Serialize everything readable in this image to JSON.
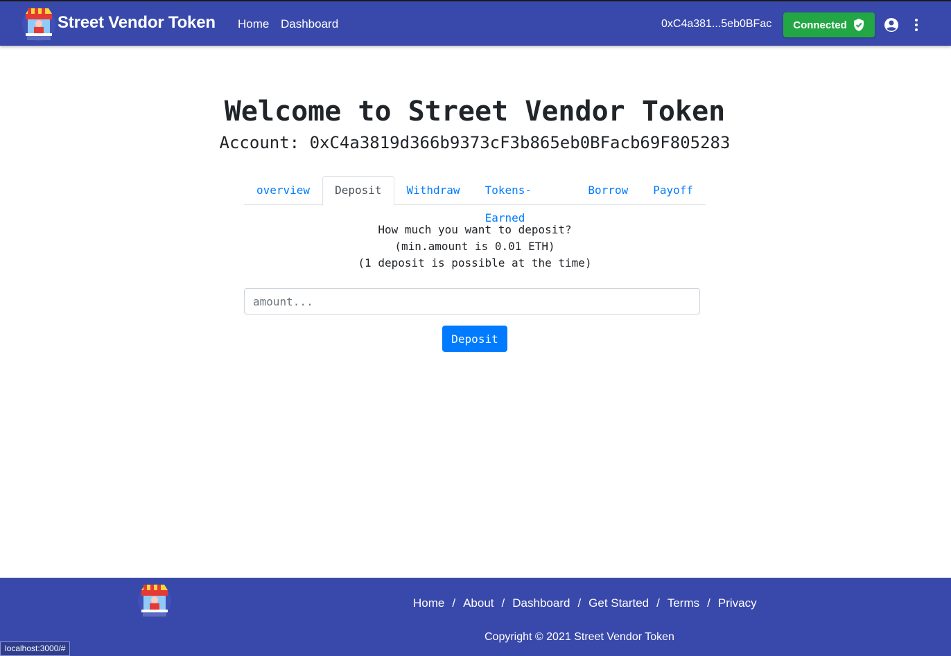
{
  "header": {
    "brand": "Street Vendor Token",
    "nav": [
      "Home",
      "Dashboard"
    ],
    "account_short": "0xC4a381...5eb0BFac",
    "status_label": "Connected"
  },
  "main": {
    "title": "Welcome to Street Vendor Token",
    "account_line": "Account: 0xC4a3819d366b9373cF3b865eb0BFacb69F805283",
    "tabs": [
      "overview",
      "Deposit",
      "Withdraw",
      "Tokens-Earned",
      "Borrow",
      "Payoff"
    ],
    "active_tab": "Deposit",
    "prompt_lines": [
      "How much you want to deposit?",
      "(min.amount is 0.01 ETH)",
      "(1 deposit is possible at the time)"
    ],
    "amount_placeholder": "amount...",
    "deposit_label": "Deposit"
  },
  "footer": {
    "links": [
      "Home",
      "About",
      "Dashboard",
      "Get Started",
      "Terms",
      "Privacy"
    ],
    "separator": "/",
    "copyright": "Copyright © 2021 Street Vendor Token"
  },
  "status_bar_url": "localhost:3000/#",
  "colors": {
    "primary_bar": "#3949ab",
    "connected_green": "#23a745",
    "link_blue": "#007bff"
  },
  "icons": [
    "vendor-stall-logo",
    "shield-check-icon",
    "account-circle-icon",
    "more-vertical-icon"
  ]
}
